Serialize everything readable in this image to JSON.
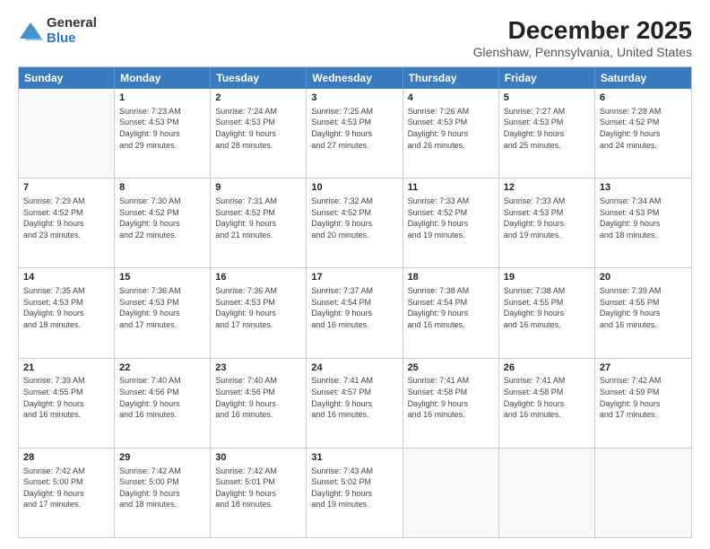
{
  "logo": {
    "general": "General",
    "blue": "Blue"
  },
  "title": "December 2025",
  "subtitle": "Glenshaw, Pennsylvania, United States",
  "header_days": [
    "Sunday",
    "Monday",
    "Tuesday",
    "Wednesday",
    "Thursday",
    "Friday",
    "Saturday"
  ],
  "weeks": [
    [
      {
        "day": "",
        "info": ""
      },
      {
        "day": "1",
        "info": "Sunrise: 7:23 AM\nSunset: 4:53 PM\nDaylight: 9 hours\nand 29 minutes."
      },
      {
        "day": "2",
        "info": "Sunrise: 7:24 AM\nSunset: 4:53 PM\nDaylight: 9 hours\nand 28 minutes."
      },
      {
        "day": "3",
        "info": "Sunrise: 7:25 AM\nSunset: 4:53 PM\nDaylight: 9 hours\nand 27 minutes."
      },
      {
        "day": "4",
        "info": "Sunrise: 7:26 AM\nSunset: 4:53 PM\nDaylight: 9 hours\nand 26 minutes."
      },
      {
        "day": "5",
        "info": "Sunrise: 7:27 AM\nSunset: 4:53 PM\nDaylight: 9 hours\nand 25 minutes."
      },
      {
        "day": "6",
        "info": "Sunrise: 7:28 AM\nSunset: 4:52 PM\nDaylight: 9 hours\nand 24 minutes."
      }
    ],
    [
      {
        "day": "7",
        "info": "Sunrise: 7:29 AM\nSunset: 4:52 PM\nDaylight: 9 hours\nand 23 minutes."
      },
      {
        "day": "8",
        "info": "Sunrise: 7:30 AM\nSunset: 4:52 PM\nDaylight: 9 hours\nand 22 minutes."
      },
      {
        "day": "9",
        "info": "Sunrise: 7:31 AM\nSunset: 4:52 PM\nDaylight: 9 hours\nand 21 minutes."
      },
      {
        "day": "10",
        "info": "Sunrise: 7:32 AM\nSunset: 4:52 PM\nDaylight: 9 hours\nand 20 minutes."
      },
      {
        "day": "11",
        "info": "Sunrise: 7:33 AM\nSunset: 4:52 PM\nDaylight: 9 hours\nand 19 minutes."
      },
      {
        "day": "12",
        "info": "Sunrise: 7:33 AM\nSunset: 4:53 PM\nDaylight: 9 hours\nand 19 minutes."
      },
      {
        "day": "13",
        "info": "Sunrise: 7:34 AM\nSunset: 4:53 PM\nDaylight: 9 hours\nand 18 minutes."
      }
    ],
    [
      {
        "day": "14",
        "info": "Sunrise: 7:35 AM\nSunset: 4:53 PM\nDaylight: 9 hours\nand 18 minutes."
      },
      {
        "day": "15",
        "info": "Sunrise: 7:36 AM\nSunset: 4:53 PM\nDaylight: 9 hours\nand 17 minutes."
      },
      {
        "day": "16",
        "info": "Sunrise: 7:36 AM\nSunset: 4:53 PM\nDaylight: 9 hours\nand 17 minutes."
      },
      {
        "day": "17",
        "info": "Sunrise: 7:37 AM\nSunset: 4:54 PM\nDaylight: 9 hours\nand 16 minutes."
      },
      {
        "day": "18",
        "info": "Sunrise: 7:38 AM\nSunset: 4:54 PM\nDaylight: 9 hours\nand 16 minutes."
      },
      {
        "day": "19",
        "info": "Sunrise: 7:38 AM\nSunset: 4:55 PM\nDaylight: 9 hours\nand 16 minutes."
      },
      {
        "day": "20",
        "info": "Sunrise: 7:39 AM\nSunset: 4:55 PM\nDaylight: 9 hours\nand 16 minutes."
      }
    ],
    [
      {
        "day": "21",
        "info": "Sunrise: 7:39 AM\nSunset: 4:55 PM\nDaylight: 9 hours\nand 16 minutes."
      },
      {
        "day": "22",
        "info": "Sunrise: 7:40 AM\nSunset: 4:56 PM\nDaylight: 9 hours\nand 16 minutes."
      },
      {
        "day": "23",
        "info": "Sunrise: 7:40 AM\nSunset: 4:56 PM\nDaylight: 9 hours\nand 16 minutes."
      },
      {
        "day": "24",
        "info": "Sunrise: 7:41 AM\nSunset: 4:57 PM\nDaylight: 9 hours\nand 16 minutes."
      },
      {
        "day": "25",
        "info": "Sunrise: 7:41 AM\nSunset: 4:58 PM\nDaylight: 9 hours\nand 16 minutes."
      },
      {
        "day": "26",
        "info": "Sunrise: 7:41 AM\nSunset: 4:58 PM\nDaylight: 9 hours\nand 16 minutes."
      },
      {
        "day": "27",
        "info": "Sunrise: 7:42 AM\nSunset: 4:59 PM\nDaylight: 9 hours\nand 17 minutes."
      }
    ],
    [
      {
        "day": "28",
        "info": "Sunrise: 7:42 AM\nSunset: 5:00 PM\nDaylight: 9 hours\nand 17 minutes."
      },
      {
        "day": "29",
        "info": "Sunrise: 7:42 AM\nSunset: 5:00 PM\nDaylight: 9 hours\nand 18 minutes."
      },
      {
        "day": "30",
        "info": "Sunrise: 7:42 AM\nSunset: 5:01 PM\nDaylight: 9 hours\nand 18 minutes."
      },
      {
        "day": "31",
        "info": "Sunrise: 7:43 AM\nSunset: 5:02 PM\nDaylight: 9 hours\nand 19 minutes."
      },
      {
        "day": "",
        "info": ""
      },
      {
        "day": "",
        "info": ""
      },
      {
        "day": "",
        "info": ""
      }
    ]
  ]
}
